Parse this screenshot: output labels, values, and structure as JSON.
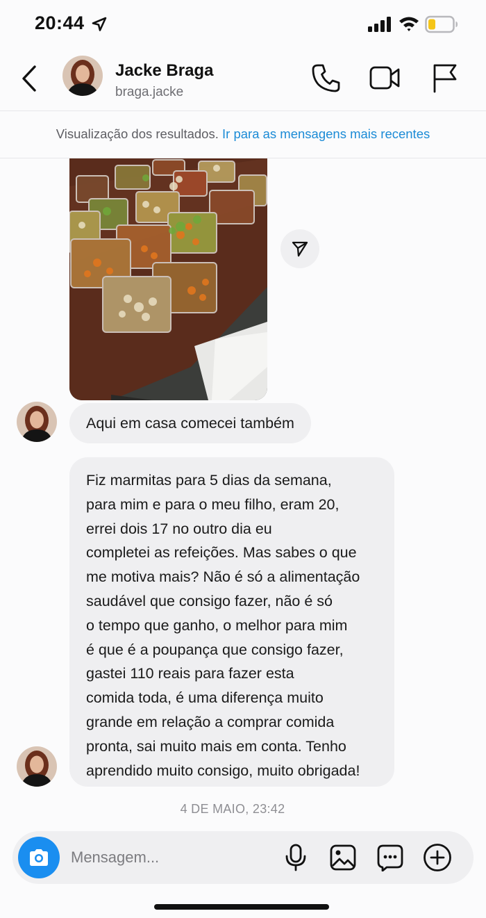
{
  "status_bar": {
    "time": "20:44",
    "icons": [
      "location-arrow-icon",
      "cellular-signal-icon",
      "wifi-icon",
      "battery-icon"
    ]
  },
  "header": {
    "contact_name": "Jacke Braga",
    "contact_handle": "braga.jacke",
    "icons": [
      "back-chevron-icon",
      "phone-icon",
      "video-camera-icon",
      "flag-icon"
    ]
  },
  "banner": {
    "prefix": "Visualização dos resultados.",
    "link": "Ir para as mensagens mais recentes"
  },
  "messages": [
    {
      "type": "image",
      "alt": "food-containers-photo"
    },
    {
      "type": "text",
      "text": "Aqui em casa comecei também"
    },
    {
      "type": "text",
      "lines": [
        "Fiz marmitas para 5 dias da semana,",
        "para mim e para o meu filho, eram 20,",
        "errei dois 17 no outro dia eu",
        "completei as refeições. Mas sabes o que",
        "me motiva mais? Não é só a alimentação",
        "saudável que consigo fazer, não é só",
        "o tempo que ganho,  o melhor para mim",
        "é que é a poupança que consigo fazer,",
        "gastei 110 reais para fazer esta",
        "comida toda, é uma diferença muito",
        "grande em relação a comprar comida",
        "pronta, sai muito mais em conta. Tenho",
        "aprendido muito consigo, muito obrigada!"
      ]
    }
  ],
  "timestamp": "4 DE MAIO, 23:42",
  "composer": {
    "placeholder": "Mensagem...",
    "icons": [
      "camera-icon",
      "microphone-icon",
      "gallery-icon",
      "sticker-icon",
      "add-icon"
    ]
  },
  "colors": {
    "accent": "#1a8ef0",
    "link": "#1b8bd6",
    "bubble": "#efeff1",
    "background": "#fbfbfc",
    "battery_low": "#f5c518"
  }
}
